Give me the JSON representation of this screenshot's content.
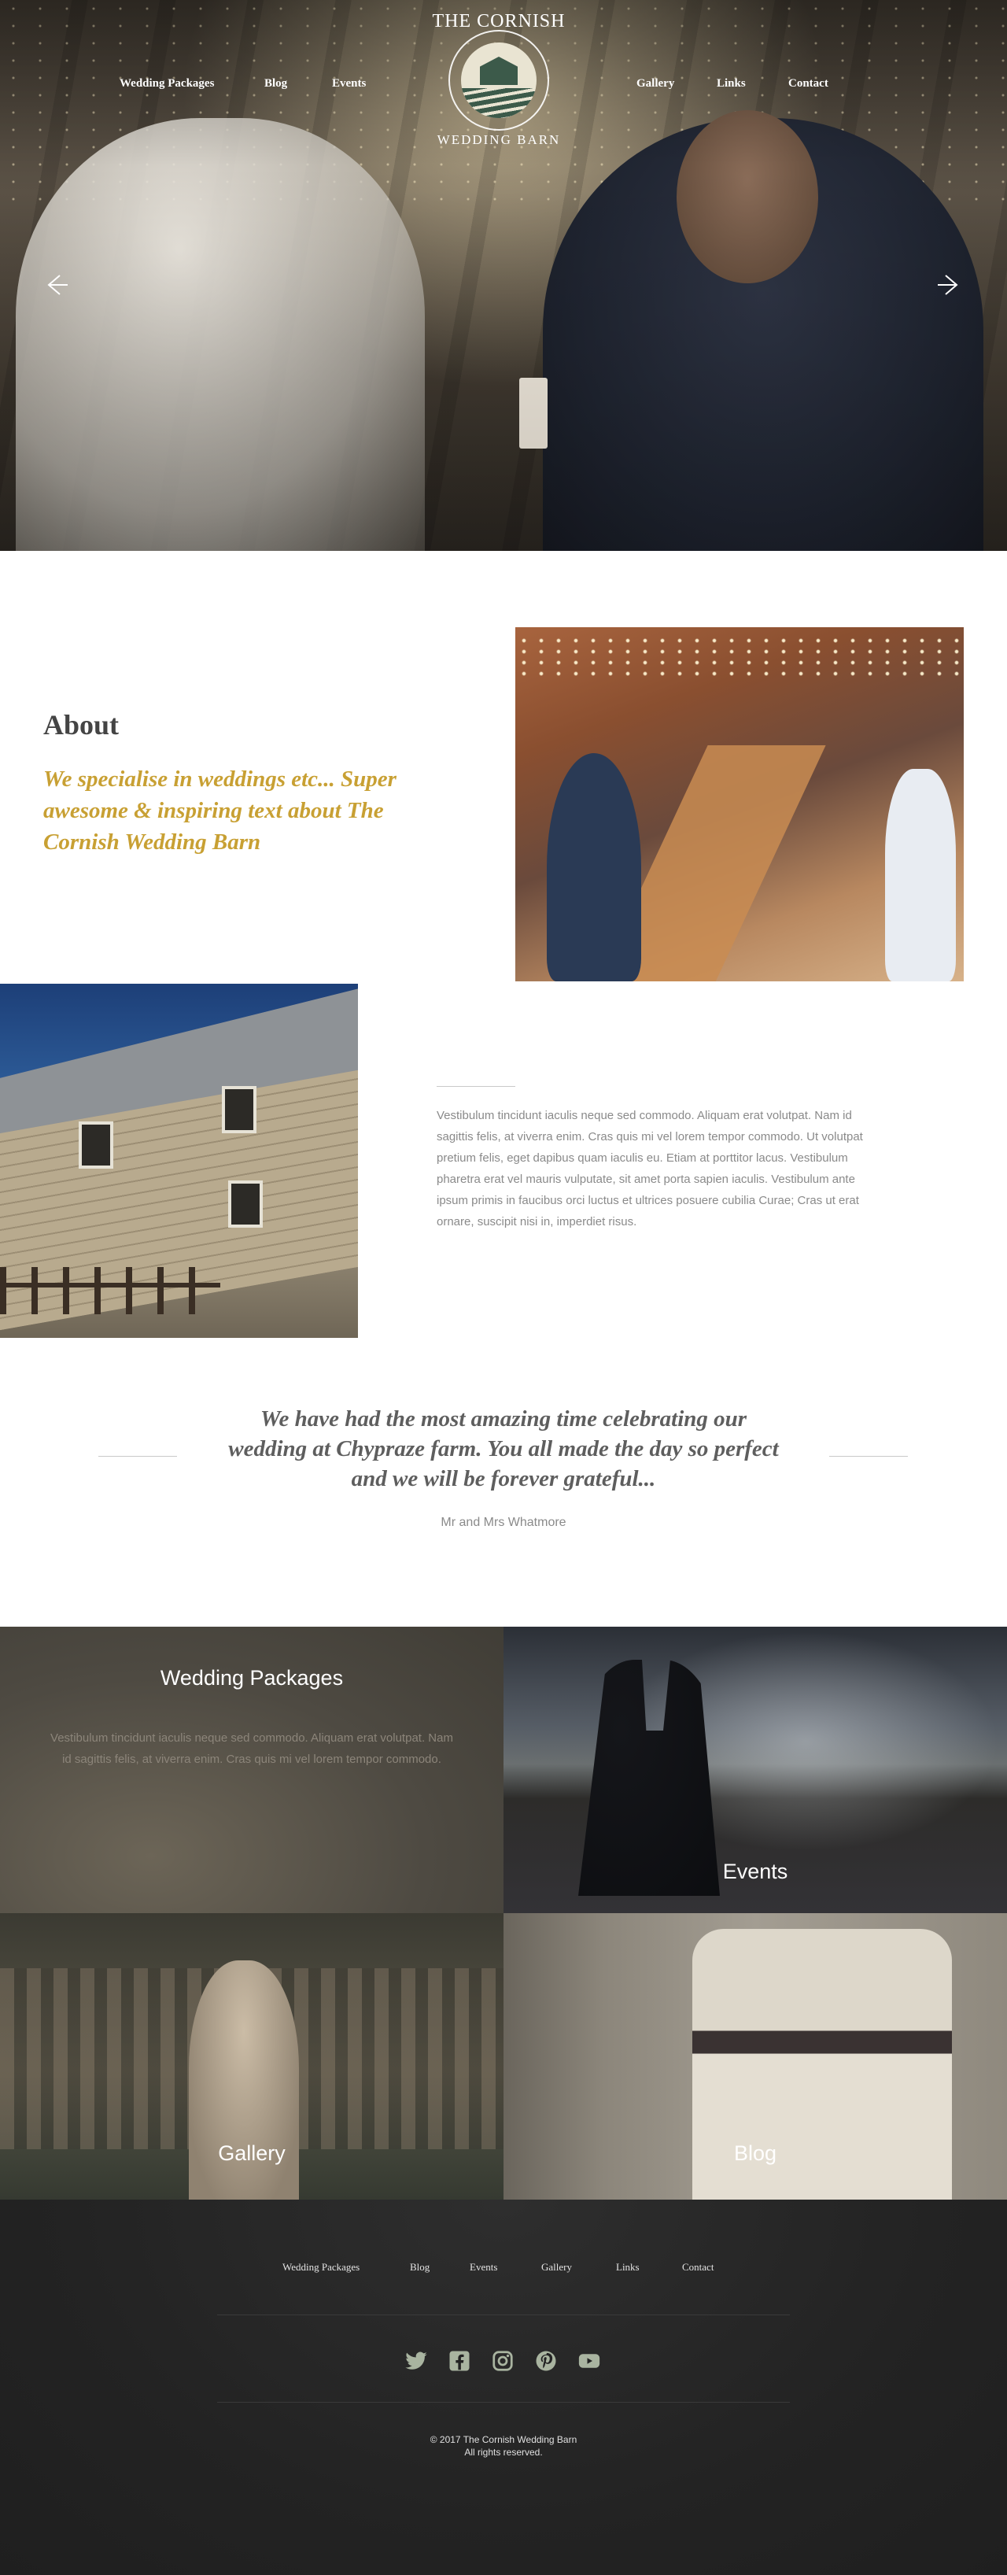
{
  "nav": {
    "left": [
      "Wedding Packages",
      "Blog",
      "Events"
    ],
    "right": [
      "Gallery",
      "Links",
      "Contact"
    ]
  },
  "logo": {
    "line1": "THE CORNISH",
    "line2": "WEDDING BARN"
  },
  "hero": {
    "prev_icon": "arrow-left-icon",
    "next_icon": "arrow-right-icon"
  },
  "about": {
    "heading": "About",
    "tagline": "We specialise in weddings etc... Super awesome & inspiring text about The Cornish Wedding Barn",
    "body": "Vestibulum tincidunt iaculis neque sed commodo. Aliquam erat volutpat. Nam id sagittis felis, at viverra enim. Cras quis mi vel lorem tempor commodo. Ut volutpat pretium felis, eget dapibus quam iaculis eu. Etiam at porttitor lacus. Vestibulum pharetra erat vel mauris vulputate, sit amet porta sapien iaculis. Vestibulum ante ipsum primis in faucibus orci luctus et ultrices posuere cubilia Curae; Cras ut erat ornare, suscipit nisi in, imperdiet risus."
  },
  "testimonial": {
    "quote": "We have had the most amazing time celebrating our wedding at Chypraze farm. You all made the day so perfect and we will be forever grateful...",
    "author": "Mr and Mrs Whatmore"
  },
  "tiles": {
    "packages": {
      "title": "Wedding Packages",
      "desc": "Vestibulum tincidunt iaculis neque sed commodo. Aliquam erat volutpat. Nam id sagittis felis, at viverra enim. Cras quis mi vel lorem tempor commodo."
    },
    "events": {
      "title": "Events"
    },
    "gallery": {
      "title": "Gallery"
    },
    "blog": {
      "title": "Blog"
    }
  },
  "footer": {
    "nav": [
      "Wedding Packages",
      "Blog",
      "Events",
      "Gallery",
      "Links",
      "Contact"
    ],
    "social": [
      "twitter-icon",
      "facebook-icon",
      "instagram-icon",
      "pinterest-icon",
      "youtube-icon"
    ],
    "copyright_line1": "© 2017 The Cornish Wedding Barn",
    "copyright_line2": "All rights reserved."
  },
  "colors": {
    "accent_gold": "#c8a033",
    "footer_bg": "#232323",
    "social_icon": "#a9b4a0"
  }
}
